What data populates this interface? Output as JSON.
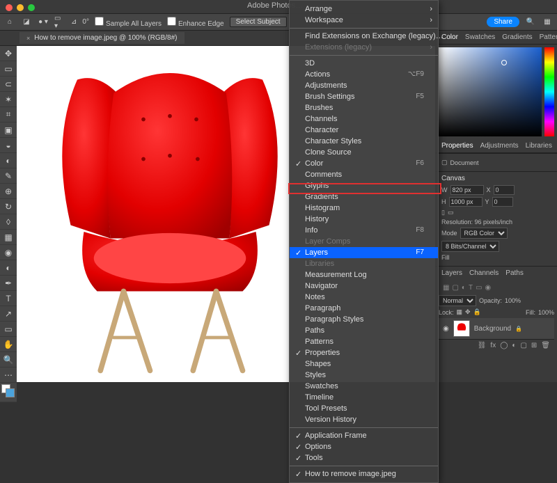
{
  "app": {
    "title": "Adobe Photos…"
  },
  "options": {
    "angle": "0°",
    "sample_all": "Sample All Layers",
    "enhance": "Enhance Edge",
    "select_subject": "Select Subject",
    "share": "Share"
  },
  "document": {
    "tab": "How to remove image.jpeg @ 100% (RGB/8#)"
  },
  "menu": {
    "items": [
      {
        "label": "Arrange",
        "sub": true
      },
      {
        "label": "Workspace",
        "sub": true
      },
      {
        "sep": true
      },
      {
        "label": "Find Extensions on Exchange (legacy)…"
      },
      {
        "label": "Extensions (legacy)",
        "sub": true,
        "dis": true
      },
      {
        "sep": true
      },
      {
        "label": "3D"
      },
      {
        "label": "Actions",
        "sc": "⌥F9"
      },
      {
        "label": "Adjustments"
      },
      {
        "label": "Brush Settings",
        "sc": "F5"
      },
      {
        "label": "Brushes"
      },
      {
        "label": "Channels"
      },
      {
        "label": "Character"
      },
      {
        "label": "Character Styles"
      },
      {
        "label": "Clone Source"
      },
      {
        "label": "Color",
        "chk": true,
        "sc": "F6"
      },
      {
        "label": "Comments"
      },
      {
        "label": "Glyphs"
      },
      {
        "label": "Gradients"
      },
      {
        "label": "Histogram"
      },
      {
        "label": "History"
      },
      {
        "label": "Info",
        "sc": "F8"
      },
      {
        "label": "Layer Comps",
        "dis": true
      },
      {
        "label": "Layers",
        "chk": true,
        "sel": true,
        "sc": "F7"
      },
      {
        "label": "Libraries",
        "dis": true
      },
      {
        "label": "Measurement Log"
      },
      {
        "label": "Navigator"
      },
      {
        "label": "Notes"
      },
      {
        "label": "Paragraph"
      },
      {
        "label": "Paragraph Styles"
      },
      {
        "label": "Paths"
      },
      {
        "label": "Patterns"
      },
      {
        "label": "Properties",
        "chk": true
      },
      {
        "label": "Shapes"
      },
      {
        "label": "Styles"
      },
      {
        "label": "Swatches"
      },
      {
        "label": "Timeline"
      },
      {
        "label": "Tool Presets"
      },
      {
        "label": "Version History"
      },
      {
        "sep": true
      },
      {
        "label": "Application Frame",
        "chk": true
      },
      {
        "label": "Options",
        "chk": true
      },
      {
        "label": "Tools",
        "chk": true
      },
      {
        "sep": true
      },
      {
        "label": "How to remove image.jpeg",
        "chk": true
      }
    ]
  },
  "color": {
    "tabs": [
      "Color",
      "Swatches",
      "Gradients",
      "Patterns"
    ]
  },
  "props": {
    "tabs": [
      "Properties",
      "Adjustments",
      "Libraries"
    ],
    "doc_label": "Document",
    "canvas_label": "Canvas",
    "w": "820 px",
    "h": "1000 px",
    "x": "0",
    "y": "0",
    "resolution": "Resolution: 96 pixels/inch",
    "mode_label": "Mode",
    "mode": "RGB Color",
    "bits": "8 Bits/Channel",
    "fill_label": "Fill"
  },
  "layers": {
    "tabs": [
      "Layers",
      "Channels",
      "Paths"
    ],
    "blend": "Normal",
    "opacity_label": "Opacity:",
    "opacity": "100%",
    "lock_label": "Lock:",
    "fill_label": "Fill:",
    "fill": "100%",
    "bg": "Background"
  }
}
